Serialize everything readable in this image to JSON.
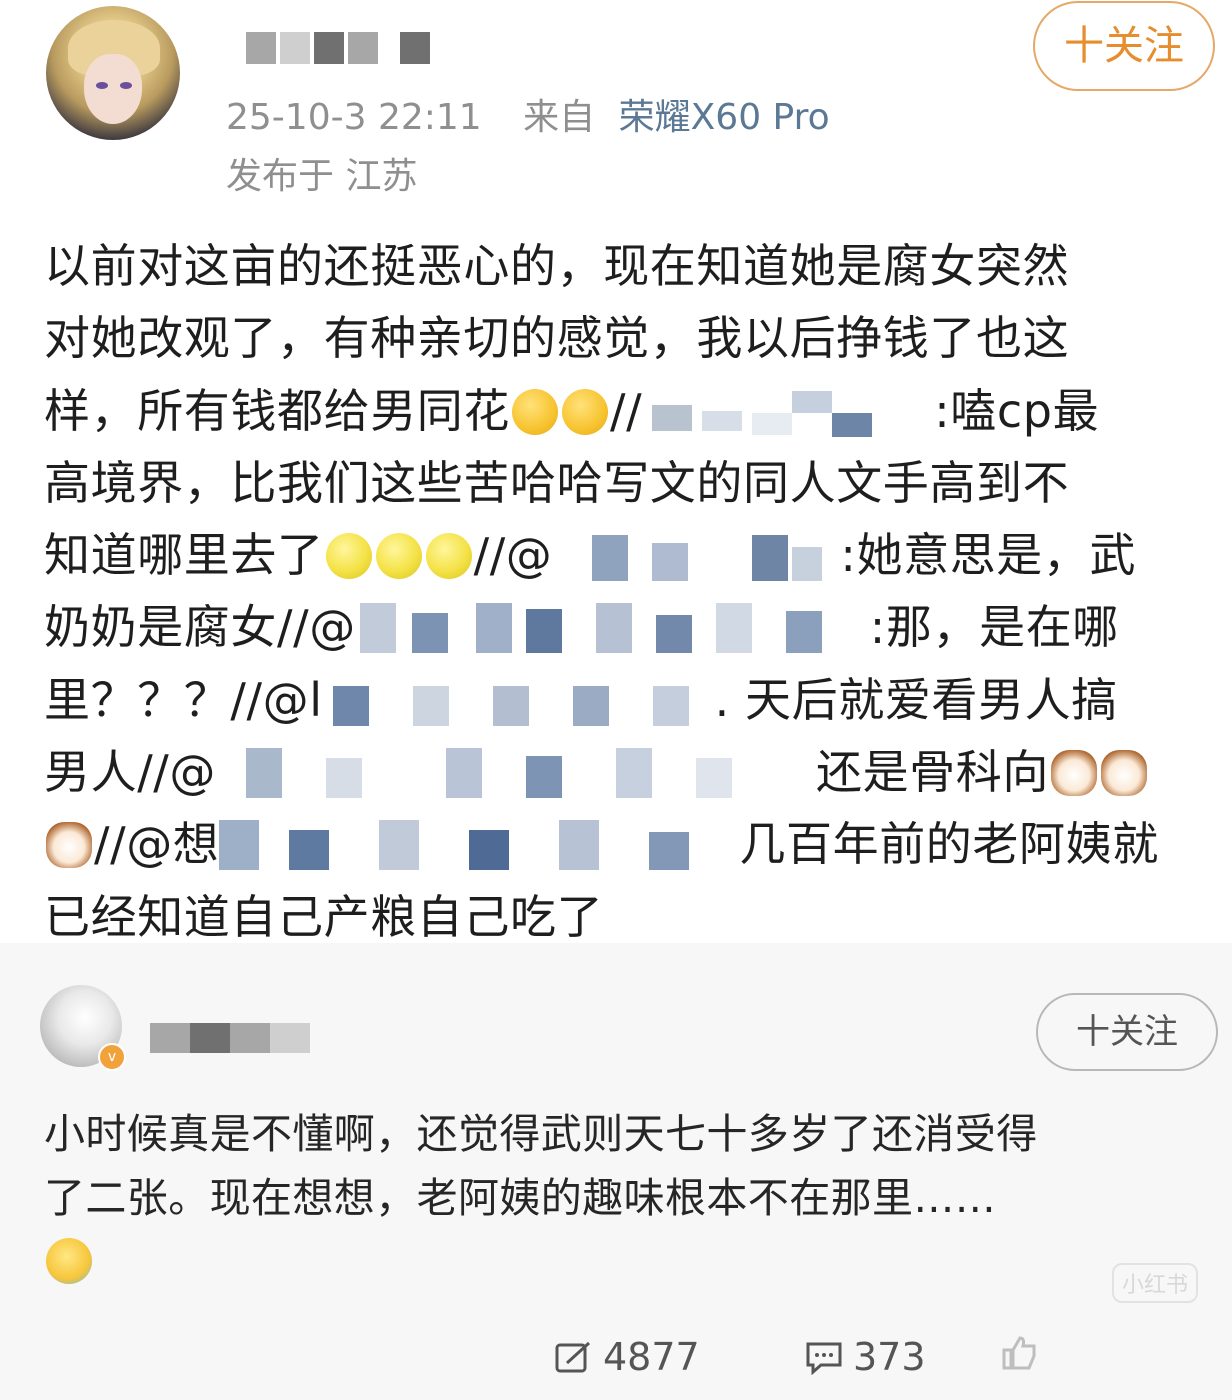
{
  "post": {
    "time": "25-10-3 22:11",
    "source_prefix": "来自",
    "device": "荣耀X60 Pro",
    "location": "发布于 江苏",
    "follow_label": "十关注",
    "text": {
      "l1": "以前对这亩的还挺恶心的，现在知道她是腐女突然",
      "l2": "对她改观了，有种亲切的感觉，我以后挣钱了也这",
      "l3a": "样，所有钱都给男同花",
      "l3b": "//",
      "l3c": ":嗑cp最",
      "l4": "高境界，比我们这些苦哈哈写文的同人文手高到不",
      "l5a": "知道哪里去了",
      "l5b": "//@",
      "l5c": ":她意思是，武",
      "l6a": "奶奶是腐女//@",
      "l6b": ":那，是在哪",
      "l7a": "里？？？//@l",
      "l7b": ". 天后就爱看男人搞",
      "l8a": "男人//@",
      "l8b": "还是骨科向",
      "l9a": "//@想",
      "l9b": "几百年前的老阿姨就",
      "l10": "已经知道自己产粮自己吃了"
    }
  },
  "reply": {
    "follow_label": "十关注",
    "text_l1": "小时候真是不懂啊，还觉得武则天七十多岁了还消受得",
    "text_l2": "了二张。现在想想，老阿姨的趣味根本不在那里……",
    "watermark": "小红书",
    "repost_count": "4877",
    "comment_count": "373"
  },
  "colors": {
    "accent": "#e78d2d",
    "device_link": "#5b7894",
    "meta_gray": "#8f8f8f"
  },
  "icons": [
    "repost-icon",
    "comment-icon",
    "like-icon",
    "verified-badge-icon"
  ]
}
